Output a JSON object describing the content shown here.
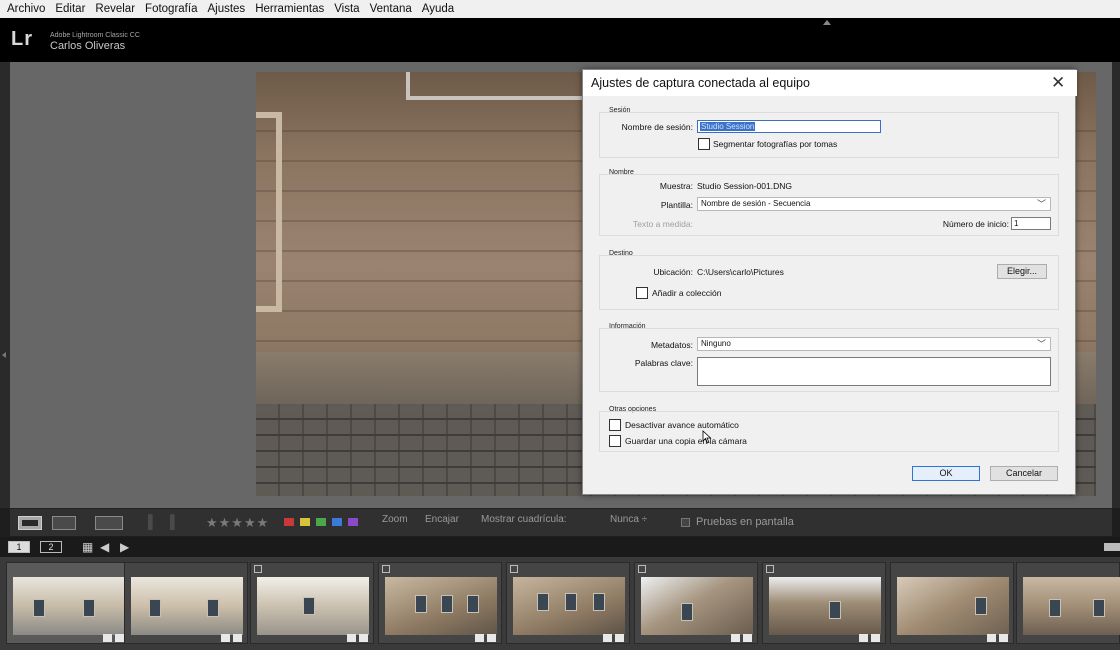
{
  "menu": [
    "Archivo",
    "Editar",
    "Revelar",
    "Fotografía",
    "Ajustes",
    "Herramientas",
    "Vista",
    "Ventana",
    "Ayuda"
  ],
  "identity": {
    "logo": "Lr",
    "product": "Adobe Lightroom Classic CC",
    "user": "Carlos Oliveras"
  },
  "toolbar": {
    "zoom_label": "Zoom",
    "fit_label": "Encajar",
    "grid_label": "Mostrar cuadrícula:",
    "grid_value": "Nunca ÷",
    "proof_label": "Pruebas en pantalla",
    "stars": "★★★★★",
    "label_colors": [
      "#c83a3a",
      "#d8c43a",
      "#4aa84a",
      "#3a7ad8",
      "#8a4ac8"
    ]
  },
  "filmstrip": {
    "view1": "1",
    "view2": "2"
  },
  "dialog": {
    "title": "Ajustes de captura conectada al equipo",
    "close": "✕",
    "session": {
      "group": "Sesión",
      "name_label": "Nombre de sesión:",
      "name_value": "Studio Session",
      "segment_label": "Segmentar fotografías por tomas"
    },
    "naming": {
      "group": "Nombre",
      "sample_label": "Muestra:",
      "sample_value": "Studio Session-001.DNG",
      "template_label": "Plantilla:",
      "template_value": "Nombre de sesión - Secuencia",
      "custom_text_label": "Texto a medida:",
      "start_label": "Número de inicio:",
      "start_value": "1"
    },
    "destination": {
      "group": "Destino",
      "location_label": "Ubicación:",
      "location_value": "C:\\Users\\carlo\\Pictures",
      "choose_label": "Elegir...",
      "add_collection_label": "Añadir a colección"
    },
    "info": {
      "group": "Información",
      "metadata_label": "Metadatos:",
      "metadata_value": "Ninguno",
      "keywords_label": "Palabras clave:"
    },
    "other": {
      "group": "Otras opciones",
      "disable_advance_label": "Desactivar avance automático",
      "save_copy_label": "Guardar una copia en la cámara"
    },
    "ok_label": "OK",
    "cancel_label": "Cancelar"
  }
}
